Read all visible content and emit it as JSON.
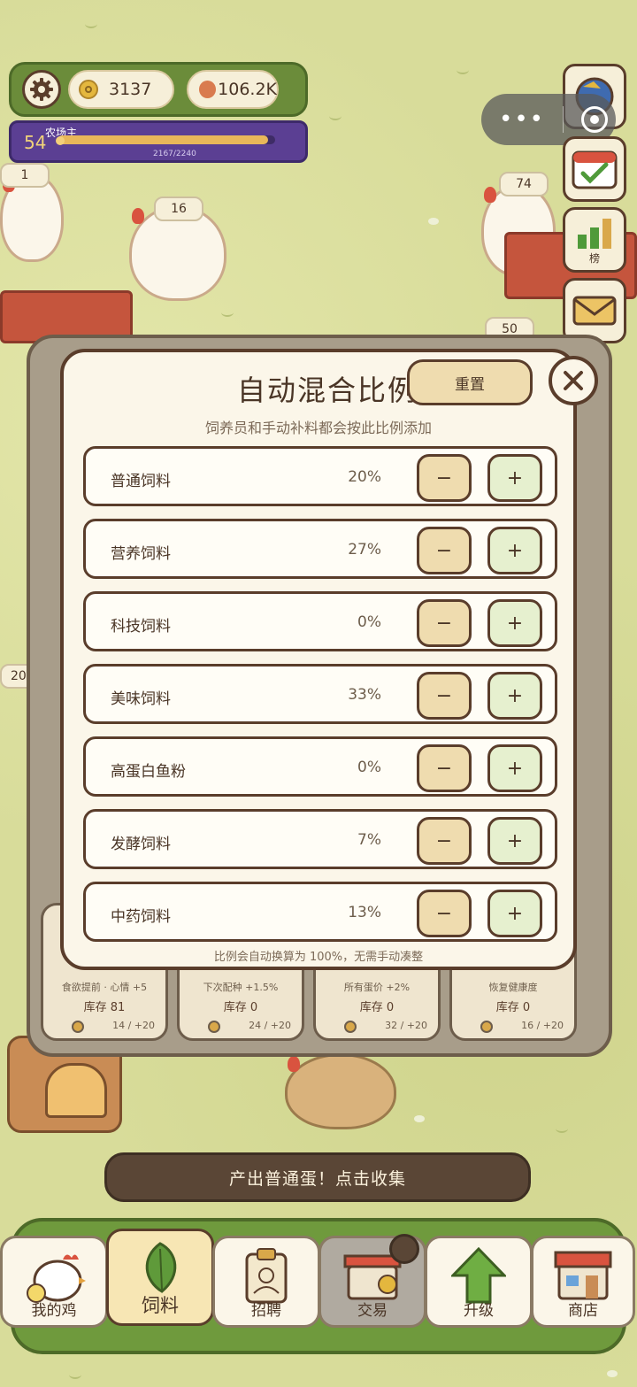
{
  "hud": {
    "coins": "3137",
    "eggs": "106.2K",
    "level": "54",
    "level_title": "农场主",
    "xp_text": "2167/2240",
    "xp_fraction": 0.967
  },
  "side": {
    "rank_label": "榜"
  },
  "chickens": {
    "tag_1": "1",
    "tag_2": "16",
    "tag_3": "74",
    "tag_4": "50",
    "tag_5": "20"
  },
  "back_cards": [
    {
      "desc": "食欲提前 · 心情 +5",
      "stock": "库存 81",
      "cost": "14 / +20"
    },
    {
      "desc": "下次配种 +1.5%",
      "stock": "库存 0",
      "cost": "24 / +20"
    },
    {
      "desc": "所有蛋价 +2%",
      "stock": "库存 0",
      "cost": "32 / +20"
    },
    {
      "desc": "恢复健康度",
      "stock": "库存 0",
      "cost": "16 / +20"
    }
  ],
  "modal": {
    "title": "自动混合比例",
    "reset_label": "重置",
    "subtitle": "饲养员和手动补料都会按此比例添加",
    "footer": "比例会自动换算为 100%，无需手动凑整",
    "minus": "−",
    "plus": "+",
    "rows": [
      {
        "name": "普通饲料",
        "pct": "20%"
      },
      {
        "name": "营养饲料",
        "pct": "27%"
      },
      {
        "name": "科技饲料",
        "pct": "0%"
      },
      {
        "name": "美味饲料",
        "pct": "33%"
      },
      {
        "name": "高蛋白鱼粉",
        "pct": "0%"
      },
      {
        "name": "发酵饲料",
        "pct": "7%"
      },
      {
        "name": "中药饲料",
        "pct": "13%"
      }
    ]
  },
  "notice": "产出普通蛋！点击收集",
  "nav": [
    {
      "label": "我的鸡"
    },
    {
      "label": "饲料"
    },
    {
      "label": "招聘"
    },
    {
      "label": "交易"
    },
    {
      "label": "升级"
    },
    {
      "label": "商店"
    }
  ],
  "colors": {
    "grass": "#d8dc9a",
    "panel": "#fbf6e9",
    "outline": "#5a3d2b",
    "minus_bg": "#efdcaf",
    "plus_bg": "#e6f0cf",
    "nav_green": "#6f9a3d",
    "level_purple": "#5b3f93"
  }
}
